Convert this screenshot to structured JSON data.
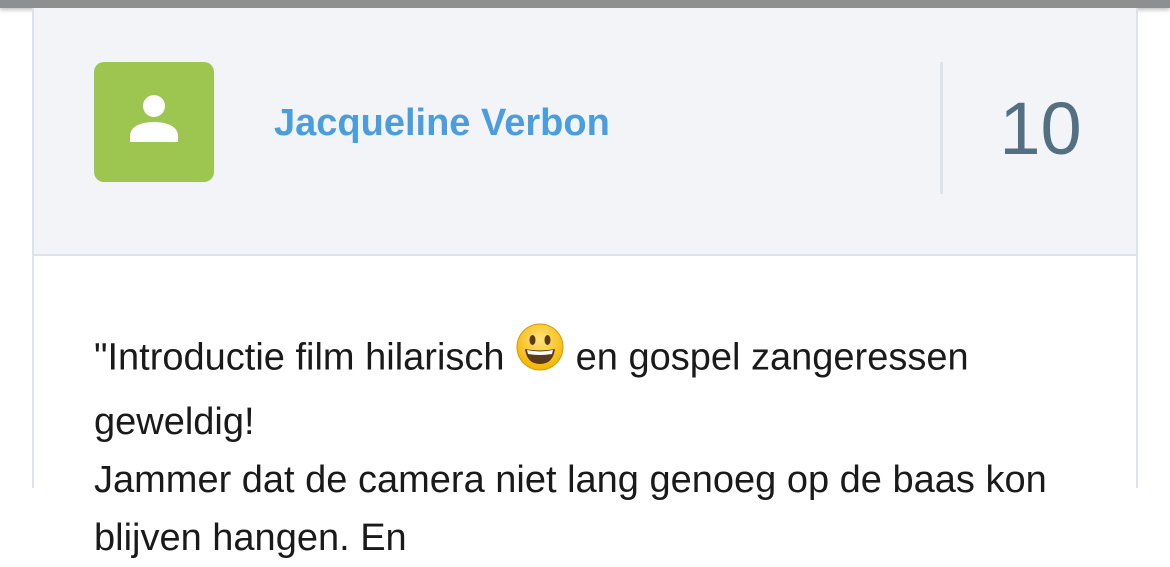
{
  "review": {
    "author": "Jacqueline Verbon",
    "score": "10",
    "text_before_emoji": "\"Introductie film hilarisch ",
    "text_after_emoji": " en gospel zangeressen geweldig!",
    "text_next_line": "Jammer dat de camera niet lang genoeg op de baas kon blijven hangen. En",
    "emoji": "grinning-face",
    "colors": {
      "avatar_bg": "#9dc651",
      "author_link": "#4a9edd",
      "score": "#546e82",
      "header_bg": "#f2f4f7"
    }
  }
}
